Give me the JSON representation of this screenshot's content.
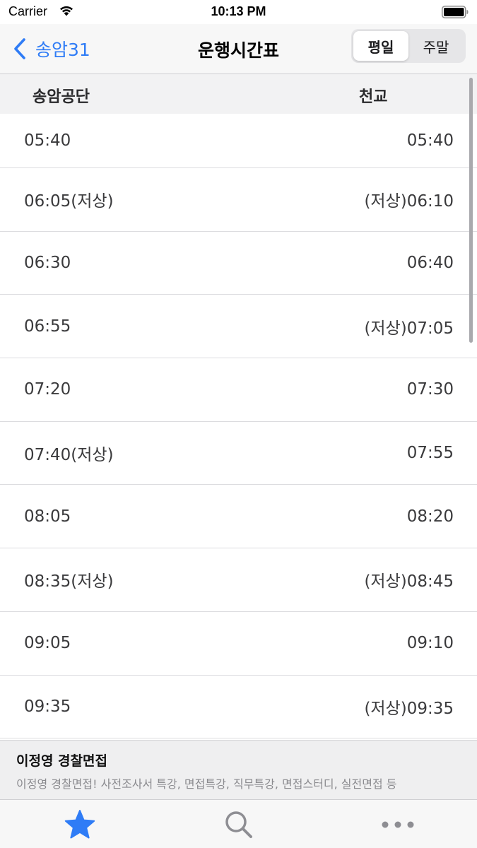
{
  "status_bar": {
    "carrier": "Carrier",
    "time": "10:13 PM"
  },
  "nav": {
    "back_label": "송암31",
    "title": "운행시간표",
    "segments": [
      {
        "label": "평일",
        "selected": true
      },
      {
        "label": "주말",
        "selected": false
      }
    ]
  },
  "columns": {
    "left": "송암공단",
    "right": "천교"
  },
  "timetable": [
    {
      "left": "05:40",
      "right": "05:40"
    },
    {
      "left": "06:05(저상)",
      "right": "(저상)06:10"
    },
    {
      "left": "06:30",
      "right": "06:40"
    },
    {
      "left": "06:55",
      "right": "(저상)07:05"
    },
    {
      "left": "07:20",
      "right": "07:30"
    },
    {
      "left": "07:40(저상)",
      "right": "07:55"
    },
    {
      "left": "08:05",
      "right": "08:20"
    },
    {
      "left": "08:35(저상)",
      "right": "(저상)08:45"
    },
    {
      "left": "09:05",
      "right": "09:10"
    },
    {
      "left": "09:35",
      "right": "(저상)09:35"
    }
  ],
  "ad": {
    "title": "이정영 경찰면접",
    "description": "이정영 경찰면접! 사전조사서 특강, 면접특강, 직무특강, 면접스터디, 실전면접 등"
  },
  "tab_bar": {
    "tabs": [
      {
        "icon": "star-icon",
        "selected": true
      },
      {
        "icon": "search-icon",
        "selected": false
      },
      {
        "icon": "more-icon",
        "selected": false
      }
    ]
  },
  "colors": {
    "accent": "#2f7cf6",
    "tab_inactive": "#8e8e93"
  }
}
